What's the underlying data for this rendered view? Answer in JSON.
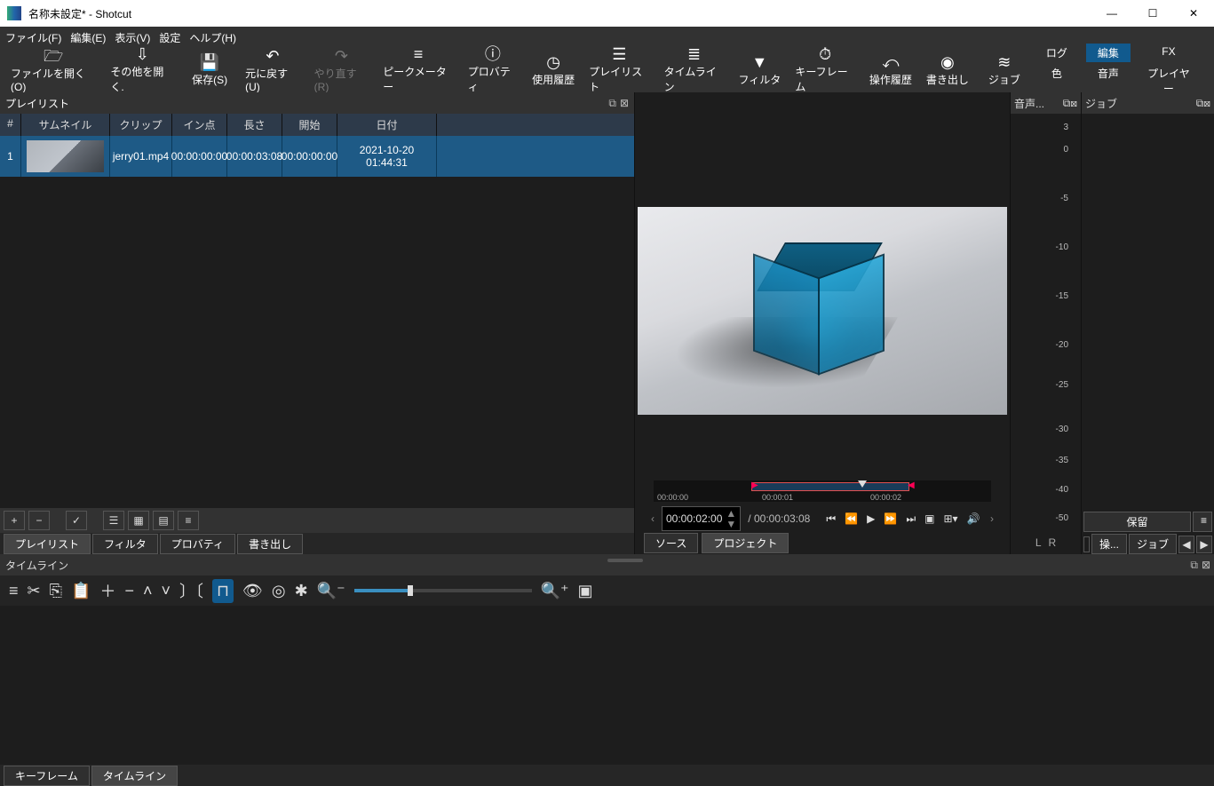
{
  "window": {
    "title": "名称未設定* - Shotcut"
  },
  "menu": {
    "file": "ファイル(F)",
    "edit": "編集(E)",
    "view": "表示(V)",
    "settings": "設定",
    "help": "ヘルプ(H)"
  },
  "toolbar": {
    "open": "ファイルを開く(O)",
    "openother": "その他を開く.",
    "save": "保存(S)",
    "undo": "元に戻す(U)",
    "redo": "やり直す(R)",
    "peakmeter": "ピークメーター",
    "properties": "プロバティ",
    "recent": "使用履歴",
    "playlist": "プレイリスト",
    "timeline": "タイムライン",
    "filters": "フィルタ",
    "keyframes": "キーフレーム",
    "history": "操作履歴",
    "export": "書き出し",
    "jobs": "ジョブ"
  },
  "sidetabs": {
    "log": "ログ",
    "edit": "編集",
    "fx": "FX",
    "color": "色",
    "audio": "音声",
    "player": "プレイヤー"
  },
  "playlist": {
    "panel": "プレイリスト",
    "headers": {
      "idx": "#",
      "thumb": "サムネイル",
      "clip": "クリップ",
      "in": "イン点",
      "len": "長さ",
      "start": "開始",
      "date": "日付"
    },
    "rows": [
      {
        "idx": "1",
        "clip": "jerry01.mp4",
        "in": "00:00:00:00",
        "len": "00:00:03:08",
        "start": "00:00:00:00",
        "date": "2021-10-20 01:44:31"
      }
    ],
    "tabs": {
      "playlist": "プレイリスト",
      "filters": "フィルタ",
      "properties": "プロバティ",
      "export": "書き出し"
    }
  },
  "preview": {
    "scrub": {
      "t0": "00:00:00",
      "t1": "00:00:01",
      "t2": "00:00:02"
    },
    "tc": "00:00:02:00",
    "dur": "/ 00:00:03:08",
    "tabs": {
      "source": "ソース",
      "project": "プロジェクト"
    }
  },
  "meter": {
    "title": "音声...",
    "labels": [
      "3",
      "0",
      "-5",
      "-10",
      "-15",
      "-20",
      "-25",
      "-30",
      "-35",
      "-40",
      "-50"
    ],
    "lr": {
      "l": "L",
      "r": "R"
    }
  },
  "jobs": {
    "title": "ジョブ",
    "hold": "保留",
    "ops": "操...",
    "job": "ジョブ"
  },
  "timeline": {
    "title": "タイムライン",
    "tabs": {
      "keyframes": "キーフレーム",
      "timeline": "タイムライン"
    }
  }
}
